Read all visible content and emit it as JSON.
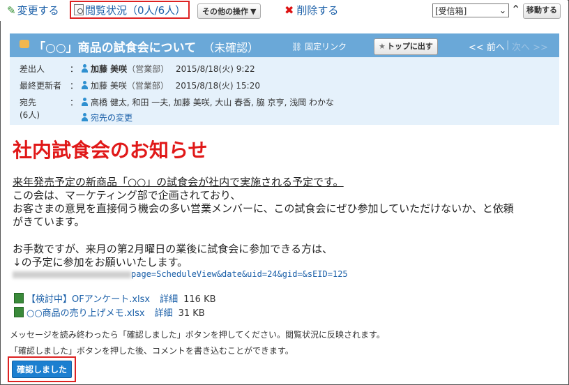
{
  "toolbar": {
    "edit_label": "変更する",
    "status_label": "閲覧状況（0人/6人）",
    "other_actions_label": "その他の操作",
    "delete_label": "削除する",
    "folder_selected": "[受信箱]",
    "move_label": "移動する"
  },
  "message": {
    "title": "「○○」商品の試食会について",
    "status": "（未確認）",
    "fixed_link_label": "固定リンク",
    "top_button_label": "トップに出す",
    "prev_label": "<< 前へ",
    "next_label": "次へ >>",
    "sender_label": "差出人",
    "sender_name": "加藤 美咲",
    "sender_dept": "（営業部）",
    "sender_date": "2015/8/18(火) 9:22",
    "updater_label": "最終更新者",
    "updater_name": "加藤 美咲",
    "updater_dept": "（営業部）",
    "updater_date": "2015/8/18(火) 15:20",
    "recipients_label": "宛先",
    "recipients_count": "(6人)",
    "recipients": "高橋 健太, 和田 一夫, 加藤 美咲, 大山 春香, 脇 京亨, 浅岡 わかな",
    "change_recipients_label": "宛先の変更",
    "colon": "："
  },
  "body": {
    "heading": "社内試食会のお知らせ",
    "line1": "来年発売予定の新商品「○○」の試食会が社内で実施される予定です。",
    "line2": "この会は、マーケティング部で企画されており、",
    "line3": "お客さまの意見を直接伺う機会の多い営業メンバーに、この試食会にぜひ参加していただけないか、と依頼",
    "line4": "がきています。",
    "line5": "お手数ですが、来月の第2月曜日の業後に試食会に参加できる方は、",
    "line6": "↓の予定に参加をお願いいたします。",
    "url_tail": "page=ScheduleView&date&uid=24&gid=&sEID=125"
  },
  "attachments": [
    {
      "name": "【検討中】OFアンケート.xlsx",
      "detail": "詳細",
      "size": "116 KB"
    },
    {
      "name": "○○商品の売り上げメモ.xlsx",
      "detail": "詳細",
      "size": "31 KB"
    }
  ],
  "notes": {
    "note1": "メッセージを読み終わったら「確認しました」ボタンを押してください。閲覧状況に反映されます。",
    "note2": "「確認しました」ボタンを押した後、コメントを書き込むことができます。"
  },
  "confirm_label": "確認しました",
  "colors": {
    "accent": "#6aa8d8",
    "heading": "#e01818",
    "link": "#1a5fa8",
    "confirm": "#1c7fd0",
    "highlight": "#dd2222"
  }
}
